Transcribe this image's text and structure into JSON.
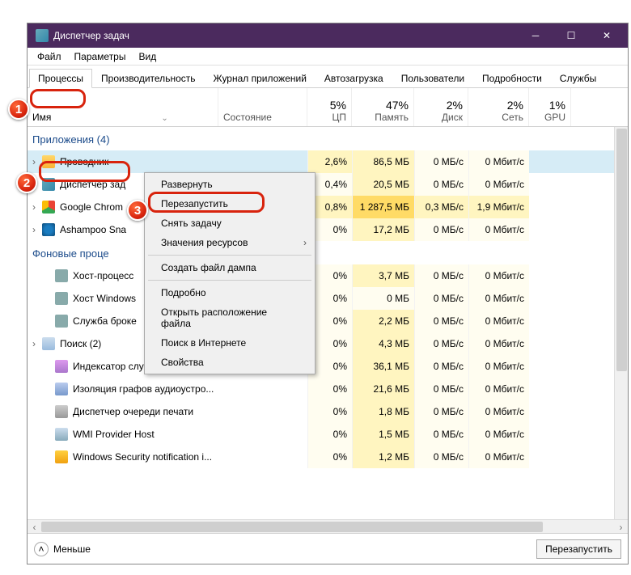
{
  "titlebar": {
    "title": "Диспетчер задач"
  },
  "menu": {
    "file": "Файл",
    "params": "Параметры",
    "view": "Вид"
  },
  "tabs": {
    "processes": "Процессы",
    "performance": "Производительность",
    "apphistory": "Журнал приложений",
    "startup": "Автозагрузка",
    "users": "Пользователи",
    "details": "Подробности",
    "services": "Службы"
  },
  "columns": {
    "name": "Имя",
    "state": "Состояние",
    "cpu_pct": "5%",
    "cpu_lbl": "ЦП",
    "mem_pct": "47%",
    "mem_lbl": "Память",
    "disk_pct": "2%",
    "disk_lbl": "Диск",
    "net_pct": "2%",
    "net_lbl": "Сеть",
    "gpu_pct": "1%",
    "gpu_lbl": "GPU"
  },
  "groups": {
    "apps": "Приложения (4)",
    "bg": "Фоновые проце"
  },
  "rows": {
    "explorer": {
      "name": "Проводник",
      "cpu": "2,6%",
      "mem": "86,5 МБ",
      "disk": "0 МБ/с",
      "net": "0 Мбит/с"
    },
    "taskmgr": {
      "name": "Диспетчер зад",
      "cpu": "0,4%",
      "mem": "20,5 МБ",
      "disk": "0 МБ/с",
      "net": "0 Мбит/с"
    },
    "chrome": {
      "name": "Google Chrom",
      "cpu": "0,8%",
      "mem": "1 287,5 МБ",
      "disk": "0,3 МБ/с",
      "net": "1,9 Мбит/с"
    },
    "snap": {
      "name": "Ashampoo Sna",
      "cpu": "0%",
      "mem": "17,2 МБ",
      "disk": "0 МБ/с",
      "net": "0 Мбит/с"
    },
    "hostproc": {
      "name": "Хост-процесс",
      "cpu": "0%",
      "mem": "3,7 МБ",
      "disk": "0 МБ/с",
      "net": "0 Мбит/с"
    },
    "hostwin": {
      "name": "Хост Windows",
      "cpu": "0%",
      "mem": "0 МБ",
      "disk": "0 МБ/с",
      "net": "0 Мбит/с"
    },
    "broker": {
      "name": "Служба броке",
      "cpu": "0%",
      "mem": "2,2 МБ",
      "disk": "0 МБ/с",
      "net": "0 Мбит/с"
    },
    "search": {
      "name": "Поиск (2)",
      "cpu": "0%",
      "mem": "4,3 МБ",
      "disk": "0 МБ/с",
      "net": "0 Мбит/с"
    },
    "indexer": {
      "name": "Индексатор службы Microsoft ...",
      "cpu": "0%",
      "mem": "36,1 МБ",
      "disk": "0 МБ/с",
      "net": "0 Мбит/с"
    },
    "audio": {
      "name": "Изоляция графов аудиоустро...",
      "cpu": "0%",
      "mem": "21,6 МБ",
      "disk": "0 МБ/с",
      "net": "0 Мбит/с"
    },
    "spooler": {
      "name": "Диспетчер очереди печати",
      "cpu": "0%",
      "mem": "1,8 МБ",
      "disk": "0 МБ/с",
      "net": "0 Мбит/с"
    },
    "wmi": {
      "name": "WMI Provider Host",
      "cpu": "0%",
      "mem": "1,5 МБ",
      "disk": "0 МБ/с",
      "net": "0 Мбит/с"
    },
    "secnotif": {
      "name": "Windows Security notification i...",
      "cpu": "0%",
      "mem": "1,2 МБ",
      "disk": "0 МБ/с",
      "net": "0 Мбит/с"
    }
  },
  "ctx": {
    "expand": "Развернуть",
    "restart": "Перезапустить",
    "endtask": "Снять задачу",
    "resvals": "Значения ресурсов",
    "dump": "Создать файл дампа",
    "details": "Подробно",
    "openloc": "Открыть расположение файла",
    "searchweb": "Поиск в Интернете",
    "props": "Свойства"
  },
  "footer": {
    "less": "Меньше",
    "restart": "Перезапустить"
  },
  "badges": {
    "b1": "1",
    "b2": "2",
    "b3": "3"
  }
}
